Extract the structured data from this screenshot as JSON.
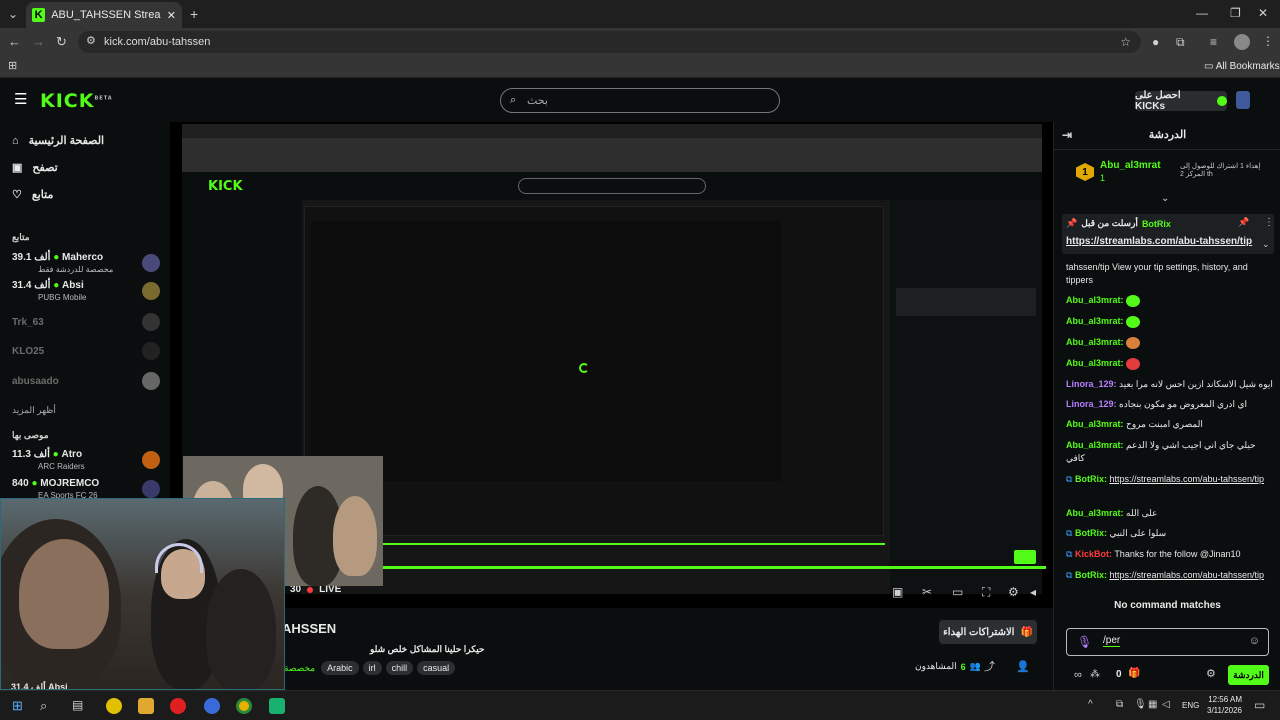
{
  "browser": {
    "tab_title": "ABU_TAHSSEN Stream - Watch",
    "url": "kick.com/abu-tahssen",
    "bookmarks_label": "All Bookmarks"
  },
  "header": {
    "logo": "KICK",
    "logo_badge": "BETA",
    "search_placeholder": "بحث",
    "get_kicks": "احصل على KICKs"
  },
  "sidebar": {
    "nav": [
      {
        "label": "الصفحة الرئيسية",
        "icon": "home-icon"
      },
      {
        "label": "تصفح",
        "icon": "browse-icon"
      },
      {
        "label": "متابع",
        "icon": "heart-icon"
      }
    ],
    "following_heading": "متابع",
    "channels": [
      {
        "name": "Maherco",
        "viewers": "39.1 ألف",
        "sub": "مخصصة للدردشة فقط",
        "live": true,
        "color": "#4a4a7a"
      },
      {
        "name": "Absi",
        "viewers": "31.4 ألف",
        "sub": "PUBG Mobile",
        "live": true,
        "color": "#7a6a30"
      },
      {
        "name": "Trk_63",
        "viewers": "",
        "sub": "",
        "live": false,
        "color": "#333"
      },
      {
        "name": "KLO25",
        "viewers": "",
        "sub": "",
        "live": false,
        "color": "#222"
      },
      {
        "name": "abusaado",
        "viewers": "",
        "sub": "",
        "live": false,
        "color": "#666"
      }
    ],
    "show_more": "أظهر المزيد",
    "recommended_heading": "موصى بها",
    "recommended": [
      {
        "name": "Atro",
        "viewers": "11.3 ألف",
        "sub": "ARC Raiders",
        "color": "#c06010"
      },
      {
        "name": "MOJREMCO",
        "viewers": "840",
        "sub": "EA Sports FC 26",
        "color": "#3a3a6a"
      }
    ],
    "partial_bottom": "31.4 ألف Absi"
  },
  "stream": {
    "live_label": "LIVE",
    "viewer_partial": "30",
    "title_partial": "AHSSEN",
    "subtitle_partial": "حيكرا حلينا المشاكل خلص شلو",
    "category_partial": "مخصصة",
    "tags": [
      "Arabic",
      "irl",
      "chill",
      "casual"
    ],
    "gift_subs_label": "الاشتراكات الهداء",
    "viewers_count": "6",
    "viewers_label": "المشاهدون",
    "inner_loading": "loading"
  },
  "chat": {
    "title": "الدردشة",
    "top_gifter": {
      "rank": "1",
      "name": "Abu_al3mrat",
      "count": "1",
      "info": "إهداء 1 اشتراك للوصول إلى المركز 2 th"
    },
    "pinned": {
      "label": "أرسلت من قبل",
      "user": "BotRix",
      "link": "https://streamlabs.com/abu-tahssen/tip"
    },
    "messages": [
      {
        "type": "text",
        "text": "tahssen/tip View your tip settings, history, and tippers"
      },
      {
        "user": "Abu_al3mrat:",
        "cls": "user-g",
        "emote": "#53fc18"
      },
      {
        "user": "Abu_al3mrat:",
        "cls": "user-g",
        "emote": "#53fc18"
      },
      {
        "user": "Abu_al3mrat:",
        "cls": "user-g",
        "emote": "#d9803c"
      },
      {
        "user": "Abu_al3mrat:",
        "cls": "user-g",
        "emote": "#e23c3c"
      },
      {
        "user": "Linora_129:",
        "cls": "user-p",
        "text": "ايوه شيل الاسكاند ازين احس لانه مرا بعيد"
      },
      {
        "user": "Linora_129:",
        "cls": "user-p",
        "text": "اي ادري المعروض مو مكون بنجاده"
      },
      {
        "user": "Abu_al3mrat:",
        "cls": "user-g",
        "text": "المصري امبنت مروح"
      },
      {
        "user": "Abu_al3mrat:",
        "cls": "user-g",
        "text": "حيلي جاي اني اجيب اشي ولا الدعم كافي"
      },
      {
        "user": "BotRix:",
        "cls": "user-g",
        "link": "https://streamlabs.com/abu-tahssen/tip"
      },
      {
        "user": "Abu_al3mrat:",
        "cls": "user-g",
        "text": "على الله"
      },
      {
        "user": "BotRix:",
        "cls": "user-g",
        "text": "سلوا على النبي"
      },
      {
        "user": "KickBot:",
        "cls": "user-r",
        "text": "Thanks for the follow @Jinan10"
      },
      {
        "user": "BotRix:",
        "cls": "user-g",
        "link": "https://streamlabs.com/abu-tahssen/tip"
      }
    ],
    "no_match": "No command matches",
    "input_value": "/per",
    "points": "0",
    "chat_button": "الدردشة"
  },
  "taskbar": {
    "lang": "ENG",
    "time": "12:56 AM",
    "date": "3/11/2026"
  }
}
